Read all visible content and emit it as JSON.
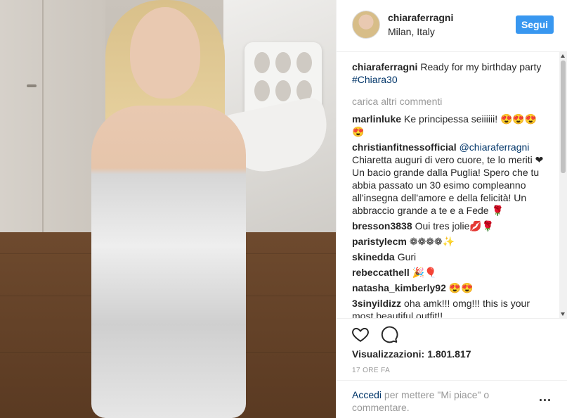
{
  "post": {
    "media_alt": "",
    "header": {
      "username": "chiaraferragni",
      "location": "Milan, Italy",
      "follow_label": "Segui"
    },
    "caption": {
      "author": "chiaraferragni",
      "text": "Ready for my birthday party",
      "hashtag": "#Chiara30"
    },
    "load_more_label": "carica altri commenti",
    "comments": [
      {
        "author": "marlinluke",
        "text": "Ke principessa seiiiiii! 😍😍😍😍"
      },
      {
        "author": "christianfitnessofficial",
        "mention": "@chiaraferragni",
        "text": "Chiaretta auguri di vero cuore, te lo meriti ❤Un bacio grande dalla Puglia! Spero che tu abbia passato un 30 esimo compleanno all'insegna dell'amore e della felicità! Un abbraccio grande a te e a Fede 🌹"
      },
      {
        "author": "bresson3838",
        "text": "Oui tres jolie💋🌹"
      },
      {
        "author": "paristylecm",
        "text": "❁❁❁❁✨"
      },
      {
        "author": "skinedda",
        "text": "Guri"
      },
      {
        "author": "rebeccathell",
        "text": "🎉🎈"
      },
      {
        "author": "natasha_kimberly92",
        "text": "😍😍"
      },
      {
        "author": "3sinyildizz",
        "text": "oha amk!!! omg!!! this is your most beautiful outfit!!"
      }
    ],
    "views_label": "Visualizzazioni:",
    "views_count": "1.801.817",
    "timestamp": "17 ORE FA",
    "login_prompt": {
      "link": "Accedi",
      "text": "per mettere \"Mi piace\" o commentare."
    },
    "icons": {
      "like": "heart-icon",
      "comment": "comment-bubble-icon",
      "more": "more-options-icon"
    },
    "colors": {
      "follow_button": "#3897f0",
      "link": "#003569",
      "muted": "#999999"
    }
  }
}
